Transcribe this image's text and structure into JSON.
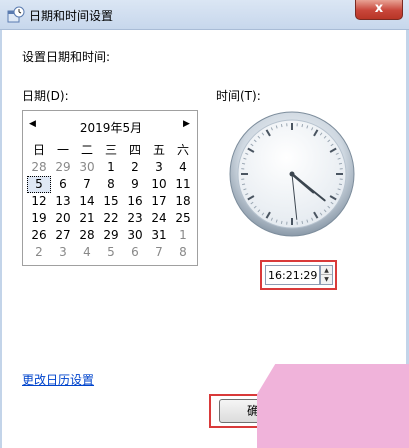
{
  "window": {
    "title": "日期和时间设置",
    "close_symbol": "x"
  },
  "section_label": "设置日期和时间:",
  "date_label": "日期(D):",
  "time_label": "时间(T):",
  "calendar": {
    "header": "2019年5月",
    "prev_symbol": "◀",
    "next_symbol": "▶",
    "weekdays": [
      "日",
      "一",
      "二",
      "三",
      "四",
      "五",
      "六"
    ],
    "weeks": [
      [
        "28",
        "29",
        "30",
        "1",
        "2",
        "3",
        "4"
      ],
      [
        "5",
        "6",
        "7",
        "8",
        "9",
        "10",
        "11"
      ],
      [
        "12",
        "13",
        "14",
        "15",
        "16",
        "17",
        "18"
      ],
      [
        "19",
        "20",
        "21",
        "22",
        "23",
        "24",
        "25"
      ],
      [
        "26",
        "27",
        "28",
        "29",
        "30",
        "31",
        "1"
      ],
      [
        "2",
        "3",
        "4",
        "5",
        "6",
        "7",
        "8"
      ]
    ],
    "selected_day": "5"
  },
  "clock": {
    "hour": 16,
    "minute": 21,
    "second": 29
  },
  "time_input": {
    "value": "16:21:29",
    "spin_up": "▲",
    "spin_down": "▼"
  },
  "link": {
    "change_calendar_settings": "更改日历设置"
  },
  "buttons": {
    "ok_label": "确"
  },
  "colors": {
    "highlight": "#d93a3a",
    "link": "#0044cc",
    "overlay": "#f0b3da"
  }
}
